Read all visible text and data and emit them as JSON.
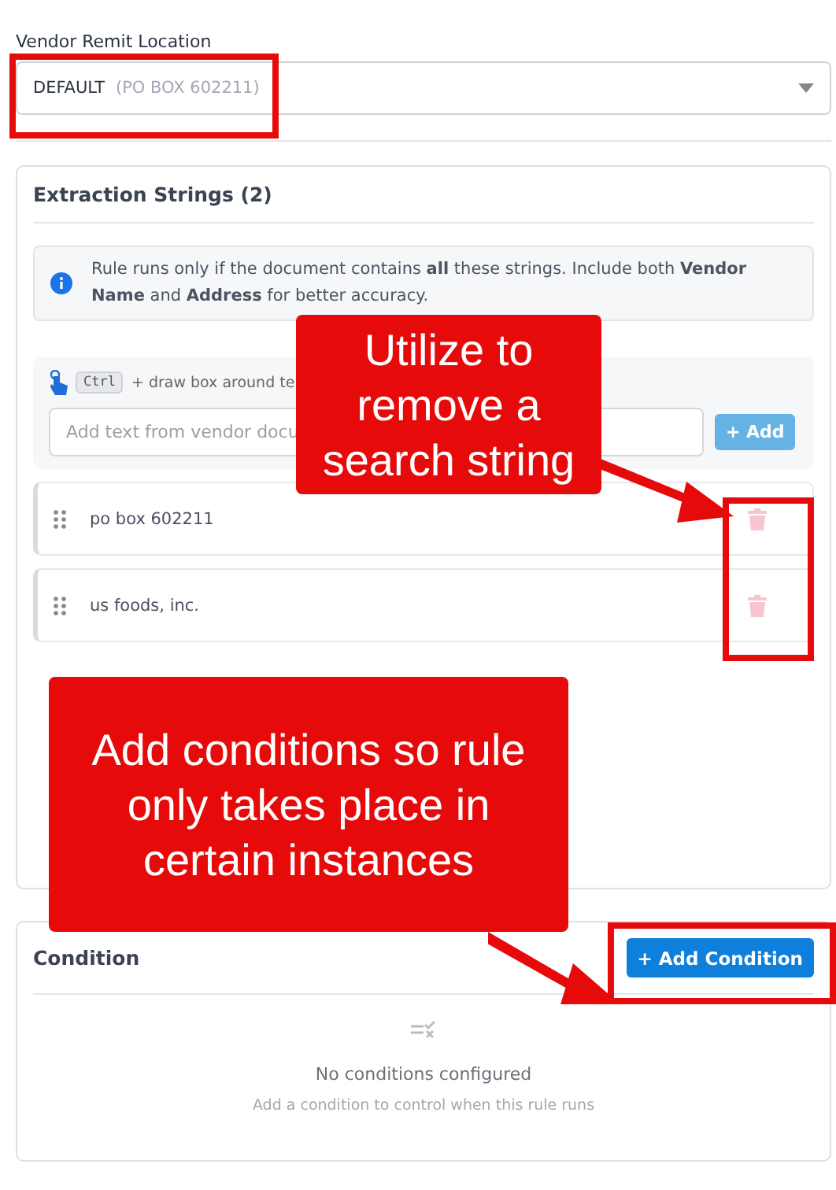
{
  "vendor_remit_location": {
    "label": "Vendor Remit Location",
    "value": "DEFAULT",
    "detail": "(PO BOX 602211)"
  },
  "extraction_strings": {
    "title": "Extraction Strings (2)",
    "info": "Rule runs only if the document contains **all** these strings. Include both **Vendor Name** and **Address** for better accuracy.",
    "capture": {
      "key": "Ctrl",
      "hint": "+ draw box around te",
      "placeholder": "Add text from vendor docu",
      "add_button": "+ Add",
      "add_disabled": true
    },
    "items": [
      {
        "text": "po box 602211"
      },
      {
        "text": "us foods, inc."
      }
    ]
  },
  "condition": {
    "title": "Condition",
    "add_button": "+ Add Condition",
    "empty_title": "No conditions configured",
    "empty_hint": "Add a condition to control when this rule runs"
  },
  "annotations": [
    {
      "text": "Utilize to remove a search string"
    },
    {
      "text": "Add conditions so rule only takes place in certain instances"
    }
  ]
}
